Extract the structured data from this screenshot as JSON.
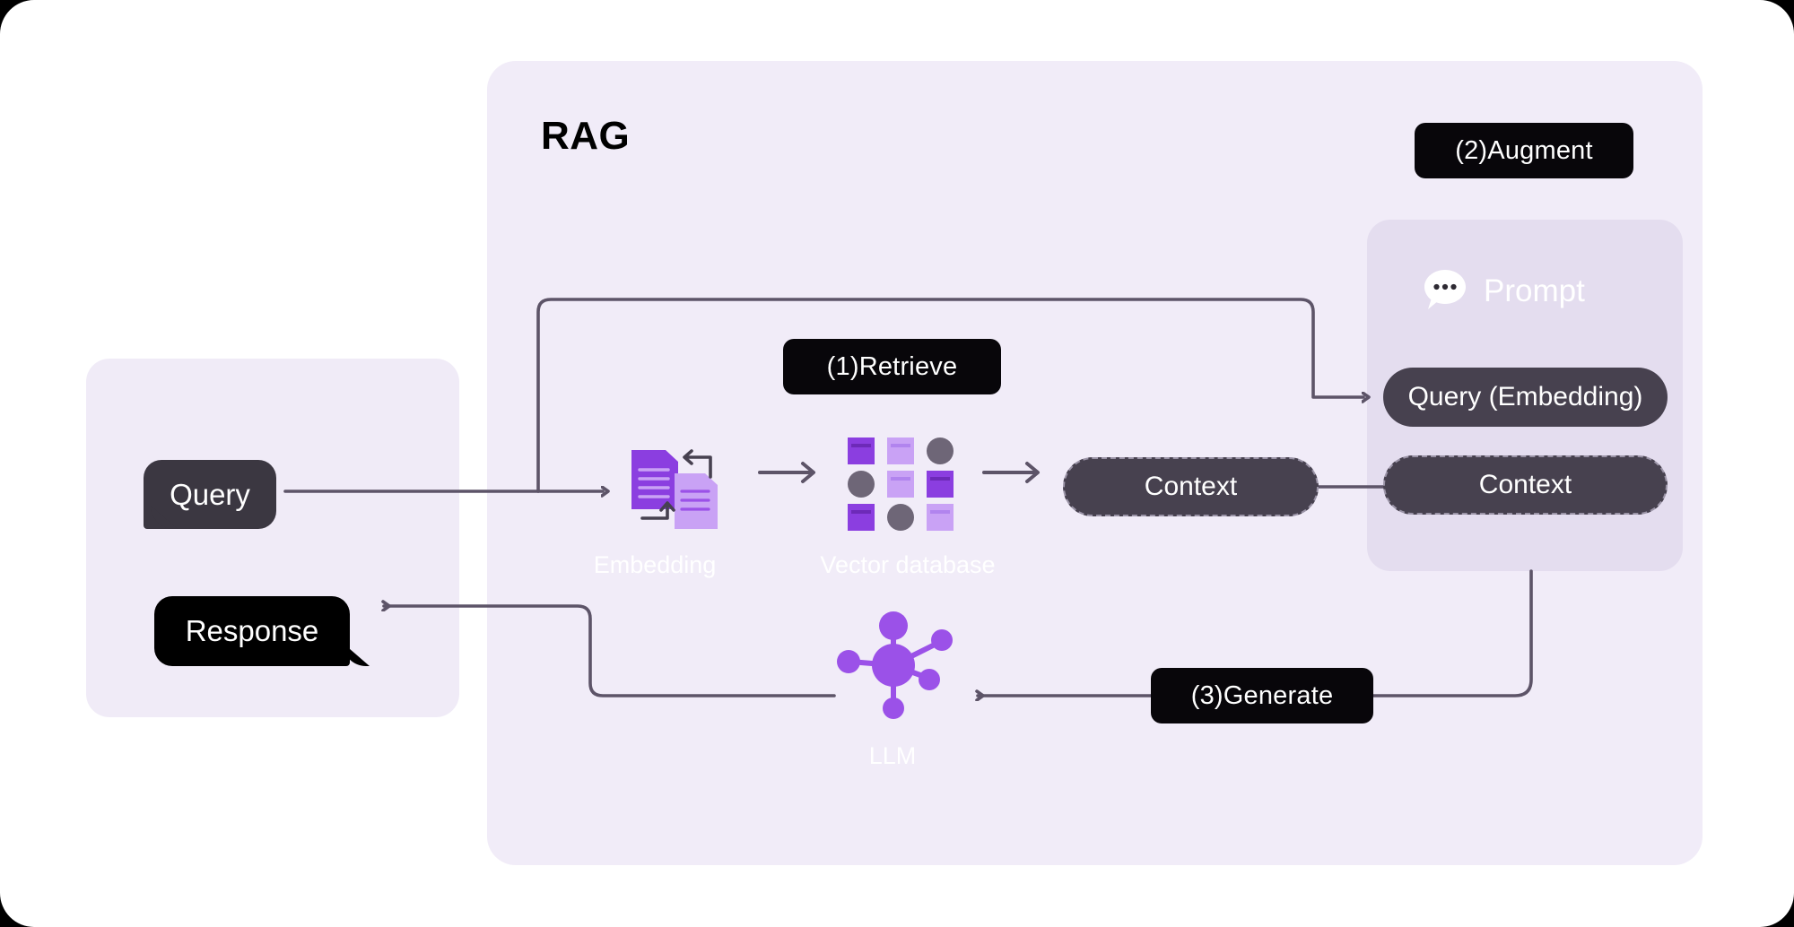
{
  "diagram": {
    "title": "RAG",
    "theme": {
      "page_bg": "#ffffff",
      "outer_bg": "#000000",
      "panel_lavender": "#f1ecf8",
      "panel_left": "#f0ebf7",
      "panel_prompt": "#e4ddef",
      "badge_black": "#08060a",
      "pill_dark": "#47414f",
      "bubble_query": "#3b3741",
      "bubble_response": "#000000",
      "wire": "#5d5468",
      "purple_dark": "#8b3ee0",
      "purple_mid": "#9b51e8",
      "purple_light": "#c9a2f5",
      "gray_node": "#6e6677",
      "label_white": "#ffffff"
    }
  },
  "steps": [
    {
      "id": "retrieve",
      "label": "(1)Retrieve"
    },
    {
      "id": "augment",
      "label": "(2)Augment"
    },
    {
      "id": "generate",
      "label": "(3)Generate"
    }
  ],
  "io": {
    "query_label": "Query",
    "response_label": "Response"
  },
  "pipeline": {
    "embedding_label": "Embedding",
    "vector_db_label": "Vector database",
    "llm_label": "LLM",
    "context_label": "Context"
  },
  "prompt_panel": {
    "header_label": "Prompt",
    "header_icon": "chat-bubble-dots-icon",
    "items": [
      {
        "label": "Query (Embedding)",
        "border": "solid"
      },
      {
        "label": "Context",
        "border": "dashed"
      }
    ]
  },
  "icons": {
    "embedding": "two-documents-sync-icon",
    "vector_db": "grid-of-squares-and-circles-icon",
    "llm": "network-nodes-icon",
    "arrow": "right-arrow-icon"
  },
  "chart_data": {
    "type": "diagram",
    "title": "RAG",
    "nodes": [
      {
        "id": "query",
        "label": "Query",
        "kind": "speech-bubble"
      },
      {
        "id": "response",
        "label": "Response",
        "kind": "speech-bubble"
      },
      {
        "id": "embedding",
        "label": "Embedding",
        "kind": "icon-node"
      },
      {
        "id": "vector_db",
        "label": "Vector database",
        "kind": "icon-node"
      },
      {
        "id": "context",
        "label": "Context",
        "kind": "pill"
      },
      {
        "id": "query_embed",
        "label": "Query (Embedding)",
        "kind": "pill"
      },
      {
        "id": "context_prom",
        "label": "Context",
        "kind": "pill"
      },
      {
        "id": "llm",
        "label": "LLM",
        "kind": "icon-node"
      },
      {
        "id": "prompt",
        "label": "Prompt",
        "kind": "group"
      }
    ],
    "edges": [
      {
        "from": "query",
        "to": "embedding",
        "step": "(1)Retrieve"
      },
      {
        "from": "query",
        "to": "query_embed",
        "step": "(2)Augment"
      },
      {
        "from": "embedding",
        "to": "vector_db",
        "step": "(1)Retrieve"
      },
      {
        "from": "vector_db",
        "to": "context",
        "step": "(1)Retrieve"
      },
      {
        "from": "context",
        "to": "context_prom",
        "step": "(2)Augment"
      },
      {
        "from": "prompt",
        "to": "llm",
        "step": "(3)Generate"
      },
      {
        "from": "llm",
        "to": "response",
        "step": "(3)Generate"
      }
    ]
  }
}
